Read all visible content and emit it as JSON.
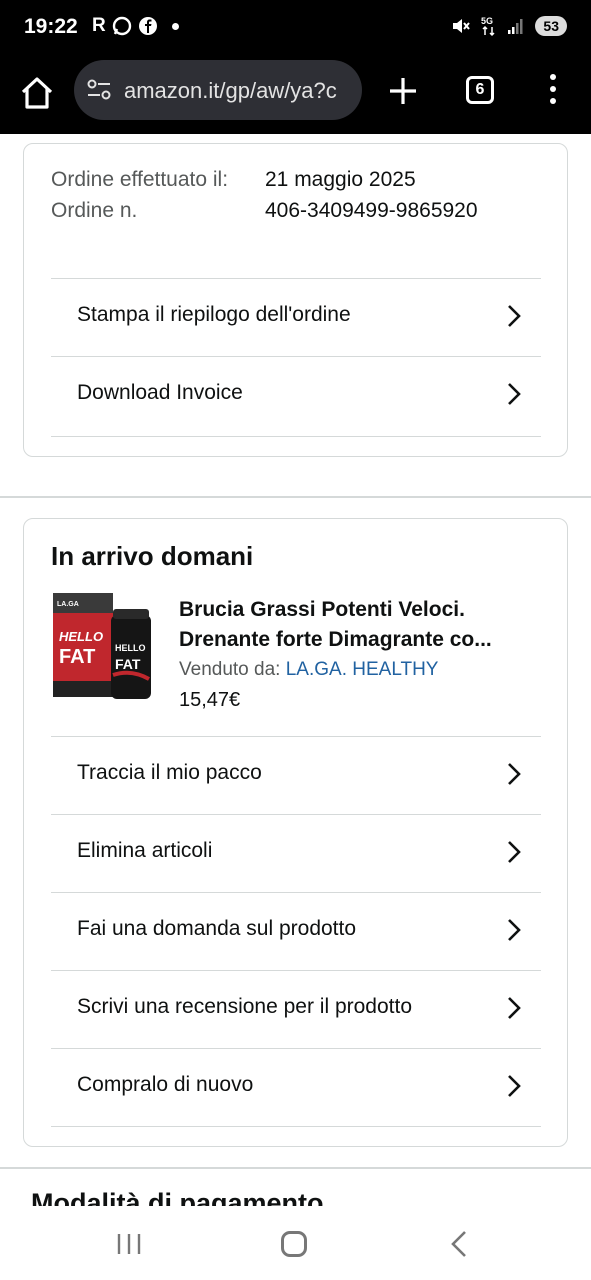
{
  "status_bar": {
    "time": "19:22",
    "left_icons": [
      "R",
      "whatsapp-icon",
      "facebook-icon"
    ],
    "battery": "53"
  },
  "browser": {
    "url": "amazon.it/gp/aw/ya?c",
    "tab_count": "6"
  },
  "order": {
    "placed_label": "Ordine effettuato il:",
    "placed_value": "21 maggio 2025",
    "number_label": "Ordine n.",
    "number_value": "406-3409499-9865920",
    "actions": [
      "Stampa il riepilogo dell'ordine",
      "Download Invoice"
    ]
  },
  "shipment": {
    "title": "In arrivo domani",
    "product_line1": "Brucia Grassi Potenti Veloci.",
    "product_line2": "Drenante forte Dimagrante co...",
    "sold_by_label": "Venduto da: ",
    "seller": "LA.GA. HEALTHY",
    "price": "15,47€",
    "product_image_text": "HELLO FAT",
    "actions": [
      "Traccia il mio pacco",
      "Elimina articoli",
      "Fai una domanda sul prodotto",
      "Scrivi una recensione per il prodotto",
      "Compralo di nuovo"
    ]
  },
  "next_section": "Modalità di pagamento",
  "colors": {
    "link": "#2162a1",
    "muted": "#565959",
    "border": "#d5d9d9"
  }
}
